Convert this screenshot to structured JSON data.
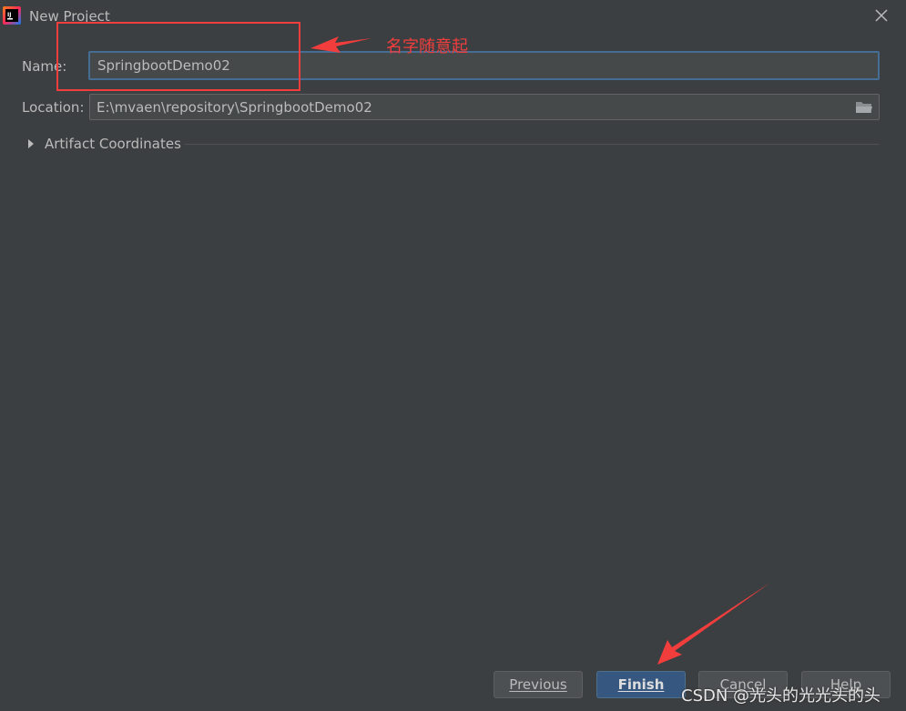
{
  "window": {
    "title": "New Project",
    "app_icon": "intellij-idea-icon",
    "close_icon": "close-icon"
  },
  "form": {
    "name_label": "Name:",
    "name_value": "SpringbootDemo02",
    "location_label": "Location:",
    "location_value": "E:\\mvaen\\repository\\SpringbootDemo02",
    "folder_icon": "folder-icon",
    "artifact_label": "Artifact Coordinates"
  },
  "buttons": {
    "previous": "Previous",
    "finish": "Finish",
    "cancel": "Cancel",
    "help": "Help"
  },
  "annotations": {
    "name_note": "名字随意起",
    "color": "#f23d3d"
  },
  "watermark": "CSDN @光头的光光头的头",
  "colors": {
    "background": "#3c3f41",
    "finish_button": "#365880",
    "focus_border": "#466d94"
  }
}
